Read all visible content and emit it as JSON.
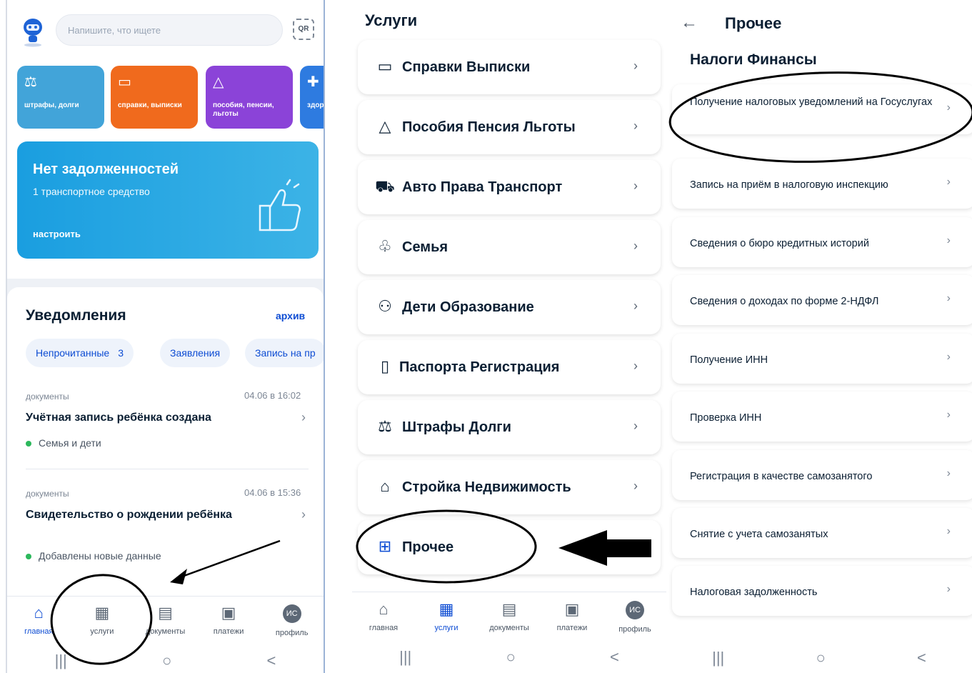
{
  "home": {
    "search_placeholder": "Напишите, что ищете",
    "qr_label": "QR",
    "tiles": [
      {
        "label": "штрафы, долги",
        "icon": "gavel-icon"
      },
      {
        "label": "справки, выписки",
        "icon": "folder-icon"
      },
      {
        "label": "пособия, пенсии, льготы",
        "icon": "bell-icon"
      },
      {
        "label": "здор",
        "icon": "plus-icon"
      }
    ],
    "debt_card": {
      "title": "Нет задолженностей",
      "subtitle": "1 транспортное средство",
      "action": "настроить"
    },
    "notifications": {
      "title": "Уведомления",
      "archive": "архив",
      "chips": [
        {
          "label": "Непрочитанные",
          "count": "3"
        },
        {
          "label": "Заявления"
        },
        {
          "label": "Запись на пр"
        }
      ],
      "items": [
        {
          "category": "документы",
          "date": "04.06 в 16:02",
          "title": "Учётная запись ребёнка создана",
          "tag": "Семья и дети"
        },
        {
          "category": "документы",
          "date": "04.06 в 15:36",
          "title": "Свидетельство о рождении ребёнка",
          "tag": "Добавлены новые данные"
        }
      ]
    }
  },
  "tabs": [
    {
      "label": "главная",
      "icon": "home-icon"
    },
    {
      "label": "услуги",
      "icon": "grid-icon"
    },
    {
      "label": "документы",
      "icon": "document-icon"
    },
    {
      "label": "платежи",
      "icon": "wallet-icon"
    },
    {
      "label": "профиль",
      "icon": "avatar-icon",
      "avatar_text": "ИС"
    }
  ],
  "sysbar": {
    "recent": "|||",
    "home": "○",
    "back": "<"
  },
  "services": {
    "title": "Услуги",
    "items": [
      {
        "label": "Справки Выписки",
        "icon": "folder-icon"
      },
      {
        "label": "Пособия Пенсия Льготы",
        "icon": "bell-icon"
      },
      {
        "label": "Авто Права Транспорт",
        "icon": "car-icon"
      },
      {
        "label": "Семья",
        "icon": "stroller-icon"
      },
      {
        "label": "Дети Образование",
        "icon": "children-icon"
      },
      {
        "label": "Паспорта Регистрация",
        "icon": "passport-icon"
      },
      {
        "label": "Штрафы Долги",
        "icon": "gavel-icon"
      },
      {
        "label": "Стройка Недвижимость",
        "icon": "house-icon"
      },
      {
        "label": "Прочее",
        "icon": "apps-icon"
      }
    ]
  },
  "other": {
    "title": "Прочее",
    "section": "Налоги Финансы",
    "items": [
      "Получение налоговых уведомлений на Госуслугах",
      "Запись на приём в налоговую инспекцию",
      "Сведения о бюро кредитных историй",
      "Сведения о доходах по форме 2-НДФЛ",
      "Получение ИНН",
      "Проверка ИНН",
      "Регистрация в качестве самозанятого",
      "Снятие с учета самозанятых",
      "Налоговая задолженность"
    ]
  },
  "colors": {
    "accent": "#0d4cd3",
    "tile1": "#42a4d9",
    "tile2": "#f06a1d",
    "tile3": "#8b43d8",
    "tile4": "#2e7be0"
  }
}
